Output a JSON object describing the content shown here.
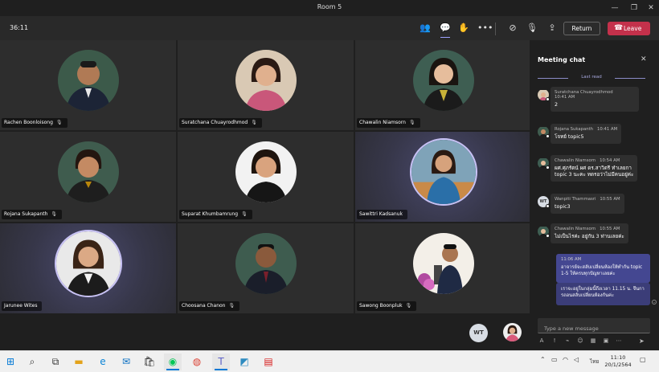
{
  "window": {
    "title": "Room 5"
  },
  "toolbar": {
    "timer": "36:11",
    "return_label": "Return",
    "leave_label": "Leave"
  },
  "participants": [
    {
      "name": "Rachen Boonloisong"
    },
    {
      "name": "Suratchana Chuayrodhmod"
    },
    {
      "name": "Chawalin Niamsorn"
    },
    {
      "name": "Rojana Sukapanth"
    },
    {
      "name": "Suparat Khumbamrung"
    },
    {
      "name": "Sawittri Kadsanuk"
    },
    {
      "name": "Jarunee Wites"
    },
    {
      "name": "Choosana Chanon"
    },
    {
      "name": "Sawong Boonpluk"
    }
  ],
  "self_initials": "WT",
  "chat": {
    "title": "Meeting chat",
    "last_read": "Last read",
    "messages": [
      {
        "sender": "Suratchana Chuayrodhmod",
        "time": "10:41 AM",
        "text": "2"
      },
      {
        "sender": "Rojana Sukapanth",
        "time": "10:41 AM",
        "text": "โจทย์ topic5"
      },
      {
        "sender": "Chawalin Niamsorn",
        "time": "10:54 AM",
        "text_1": "ผศ.ศุภรัตน์ ผศ ดร.สาวิตรี ทำเลยกา",
        "text_2": "topic 3 นะคะ ทดรอว่าไม่มีคนอยู่ค่ะ"
      },
      {
        "sender": "Wanpiti Thammasri",
        "initials": "WT",
        "time": "10:55 AM",
        "text": "topic3"
      },
      {
        "sender": "Chawalin Niamsorn",
        "time": "10:55 AM",
        "text": "ไม่เป็นไรค่ะ อยู่กัน 3 ท่านเลยค่ะ"
      }
    ],
    "my_messages": {
      "time": "11:06 AM",
      "text_1": "อาจารย์จะสลับเปลี่ยนห้องให้ทำกัน topic 1-5 ให้ครบทุกปัญหาเลยค่ะ",
      "text_2": "เราจะอยู่ในกลุ่มนี้ถึงเวลา 11.15 น. จึนการถอนสลับเปลี่ยนห้องกันค่ะ"
    },
    "compose_placeholder": "Type a new message"
  },
  "taskbar": {
    "clock_time": "11:10",
    "clock_date": "20/1/2564",
    "lang": "ไทย"
  }
}
